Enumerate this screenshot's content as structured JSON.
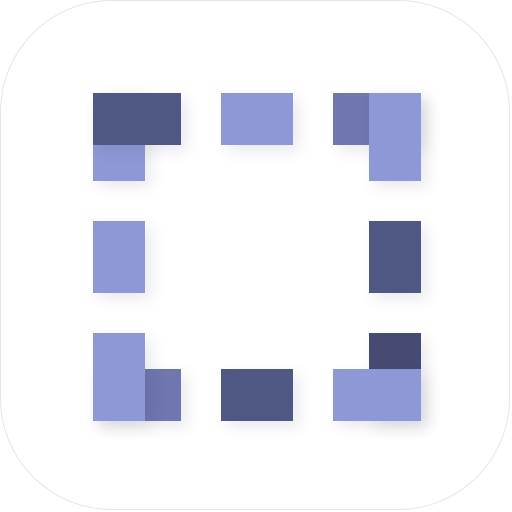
{
  "app_icon": {
    "icon_name": "dashed-selection-frame-icon",
    "background_color": "#ffffff",
    "colors": {
      "light": "#8e98d6",
      "medium": "#6f76b0",
      "dark": "#4f5784",
      "darkest": "#454b72"
    },
    "frame_segments": [
      "top-left-corner",
      "top-edge",
      "top-right-corner",
      "left-edge",
      "right-edge",
      "bottom-left-corner",
      "bottom-edge",
      "bottom-right-corner"
    ]
  }
}
